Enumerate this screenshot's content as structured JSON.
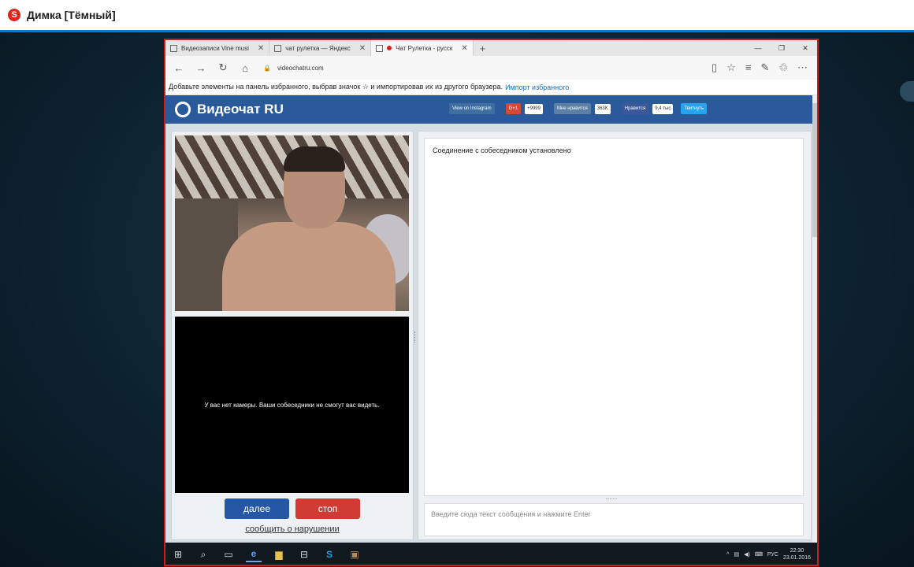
{
  "skype": {
    "title": "Димка [Тёмный]",
    "logo_letter": "S"
  },
  "browser": {
    "tabs": [
      {
        "label": "Видеозаписи Vine musi",
        "close": "✕"
      },
      {
        "label": "чат рулетка — Яндекс",
        "close": "✕"
      },
      {
        "label": "Чат Рулетка - русск",
        "close": "✕",
        "active": true
      }
    ],
    "new_tab": "+",
    "url": "videochatru.com",
    "fav_text": "Добавьте элементы на панель избранного, выбрав значок ☆ и импортировав их из другого браузера.",
    "fav_link": "Импорт избранного"
  },
  "site": {
    "logo": "Видеочат RU",
    "social": {
      "instagram": "View on Instagram",
      "gplus": "G+1",
      "gplus_count": "+9999",
      "vk": "Мне нравится",
      "vk_count": "363K",
      "fb": "Нравится",
      "fb_count": "9,4 тыс",
      "twitter": "Твитнуть"
    },
    "no_camera": "У вас нет камеры. Ваши собеседники не смогут вас видеть.",
    "next_button": "далее",
    "stop_button": "стоп",
    "report_link": "сообщить о нарушении",
    "chat_status": "Соединение с собеседником установлено",
    "message_placeholder": "Введите сюда текст сообщения и нажмите Enter"
  },
  "taskbar": {
    "lang": "РУС",
    "time": "22:30",
    "date": "23.01.2016"
  }
}
